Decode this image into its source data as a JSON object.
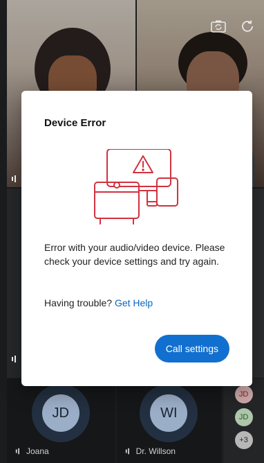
{
  "modal": {
    "title": "Device Error",
    "message": "Error with your audio/video device. Please check your device settings and try again.",
    "help_prefix": "Having trouble?",
    "help_link": "Get Help",
    "button_label": "Call settings",
    "illustration_icon": "device-warning-icon",
    "accent_color": "#d2313f"
  },
  "top_controls": {
    "icons": [
      "switch-camera-icon",
      "refresh-icon"
    ]
  },
  "participants": [
    {
      "initials": "JD",
      "name": "Joana"
    },
    {
      "initials": "WI",
      "name": "Dr. Willson"
    }
  ],
  "overflow": {
    "avatars": [
      "JD",
      "JD",
      "+3"
    ]
  },
  "colors": {
    "primary_button": "#1170cf",
    "link": "#0a66c2"
  }
}
